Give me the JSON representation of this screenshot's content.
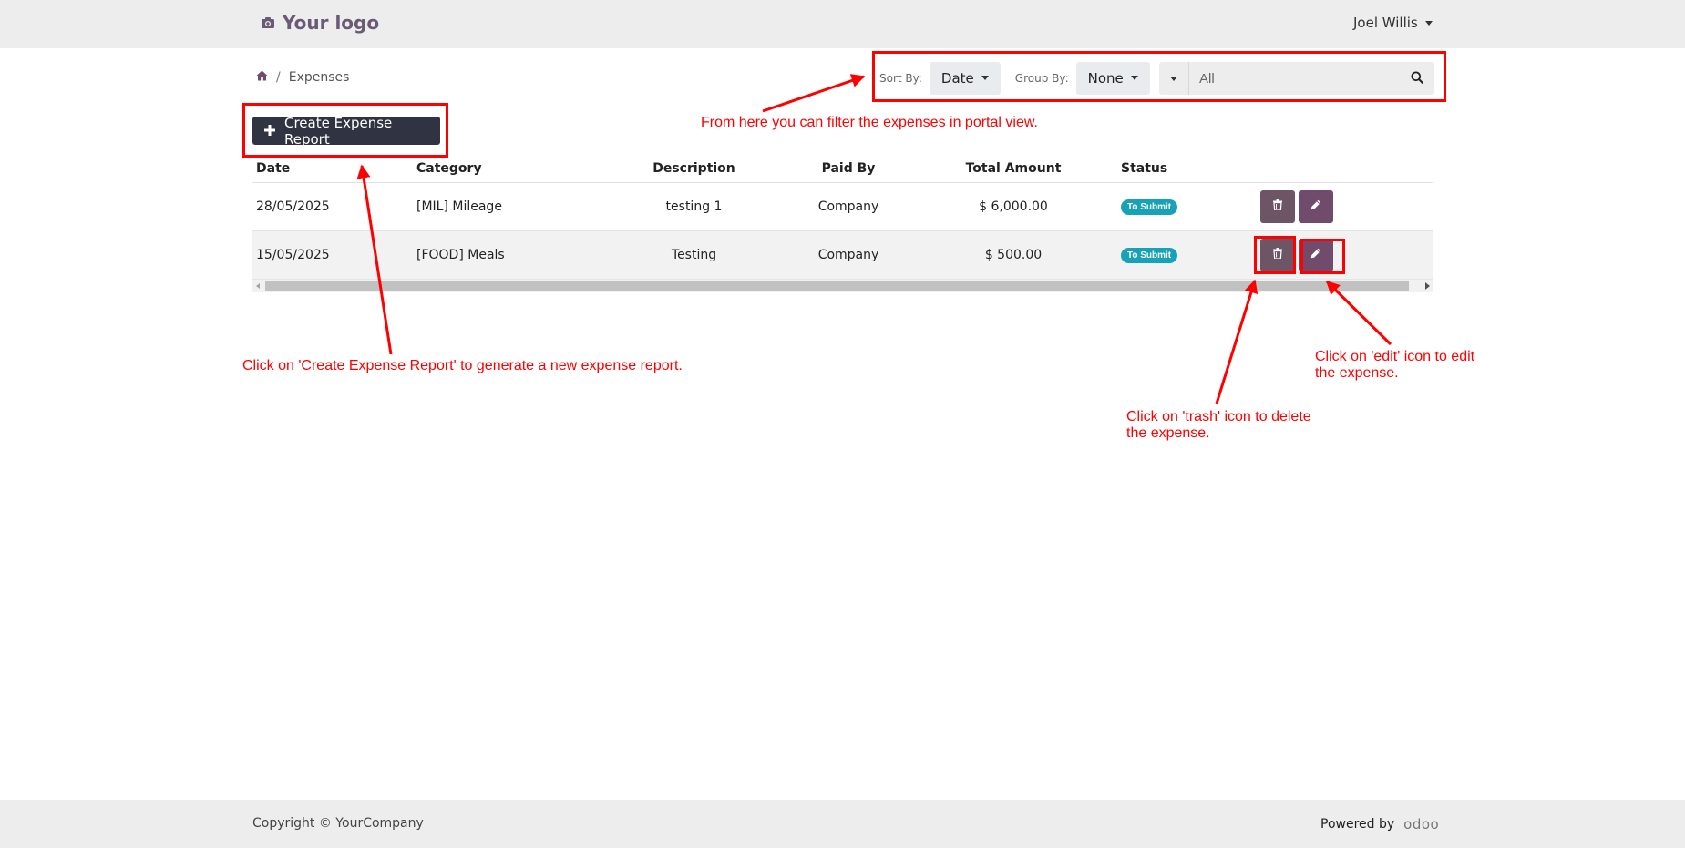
{
  "header": {
    "logo_text": "Your logo",
    "user_name": "Joel Willis"
  },
  "breadcrumb": {
    "current": "Expenses"
  },
  "filters": {
    "sort_label": "Sort By:",
    "sort_value": "Date",
    "group_label": "Group By:",
    "group_value": "None",
    "search_value": "All"
  },
  "actions": {
    "create_label": "Create Expense Report"
  },
  "table": {
    "columns": [
      "Date",
      "Category",
      "Description",
      "Paid By",
      "Total Amount",
      "Status"
    ],
    "rows": [
      {
        "date": "28/05/2025",
        "category": "[MIL] Mileage",
        "description": "testing 1",
        "paid_by": "Company",
        "total": "$ 6,000.00",
        "status": "To Submit"
      },
      {
        "date": "15/05/2025",
        "category": "[FOOD] Meals",
        "description": "Testing",
        "paid_by": "Company",
        "total": "$ 500.00",
        "status": "To Submit"
      }
    ]
  },
  "annotations": {
    "filter_note": "From here you can filter the expenses in portal view.",
    "create_note": "Click on 'Create Expense Report' to generate a new expense report.",
    "trash_note_line1": "Click on 'trash' icon to delete",
    "trash_note_line2": "the expense.",
    "edit_note_line1": "Click on 'edit' icon to edit",
    "edit_note_line2": "the expense."
  },
  "footer": {
    "copyright": "Copyright © YourCompany",
    "powered_by": "Powered by",
    "brand": "odoo"
  },
  "colors": {
    "accent": "#714b6b",
    "dark_button": "#303342",
    "badge": "#17a2b8",
    "annotation": "#ff0000"
  },
  "icons": [
    "camera-icon",
    "home-icon",
    "chevron-down-icon",
    "search-icon",
    "plus-icon",
    "trash-icon",
    "pencil-icon"
  ]
}
